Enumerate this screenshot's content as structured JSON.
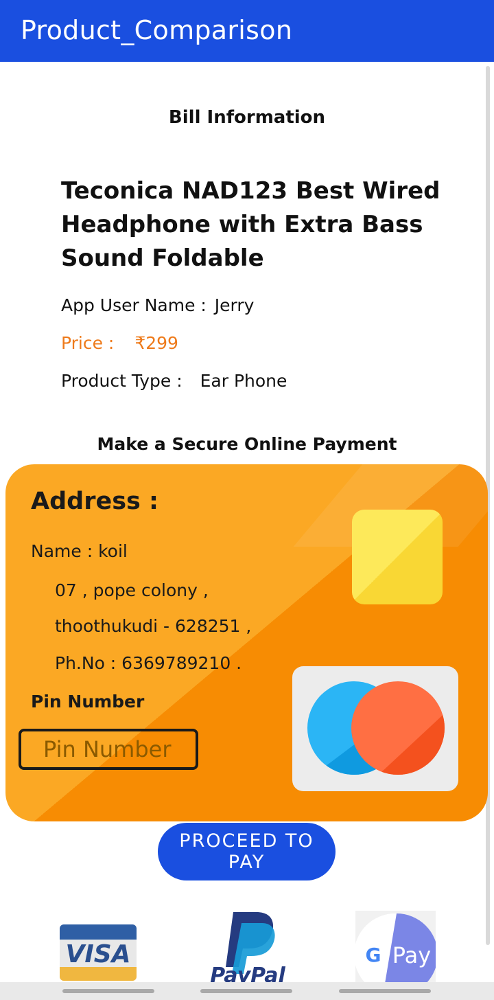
{
  "app": {
    "title": "Product_Comparison"
  },
  "bill": {
    "heading": "Bill Information",
    "product_name": "Teconica NAD123 Best Wired Headphone with Extra Bass Sound Foldable",
    "user_label": "App User Name :",
    "user_value": "Jerry",
    "price_label": "Price :",
    "price_value": "₹299",
    "type_label": "Product Type :",
    "type_value": "Ear Phone"
  },
  "payment": {
    "heading": "Make a Secure Online Payment",
    "address_title": "Address :",
    "name_line": "Name : koil",
    "address_line1": "07 , pope colony ,",
    "address_line2": "thoothukudi  - 628251 ,",
    "phone_line": "Ph.No : 6369789210 .",
    "pin_label": "Pin Number",
    "pin_placeholder": "Pin Number",
    "pay_button": "PROCEED TO PAY"
  },
  "methods": {
    "visa": "VISA",
    "paypal": "PayPal",
    "gpay_g": "G",
    "gpay_text": "Pay"
  },
  "colors": {
    "primary": "#1a4fe0",
    "card_orange": "#f78c03",
    "card_orange_light": "#fba824",
    "price_orange": "#ee7a1a"
  }
}
